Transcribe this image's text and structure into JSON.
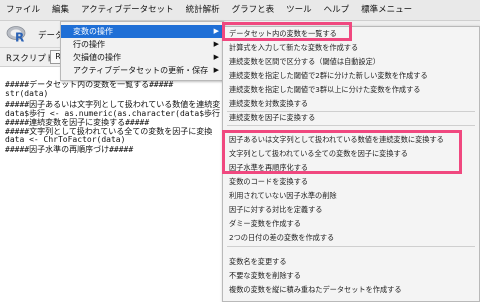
{
  "menubar": [
    "ファイル",
    "編集",
    "アクティブデータセット",
    "統計解析",
    "グラフと表",
    "ツール",
    "ヘルプ",
    "標準メニュー"
  ],
  "toolbar": {
    "label": "データセ"
  },
  "scriptbar": {
    "tab_label": "Rスクリプト",
    "button_label": "R"
  },
  "editor_lines": [
    "#####データセット内の変数を一覧する#####",
    "str(data)",
    "#####因子あるいは文字列として扱われている数値を連続変",
    "data$歩行 <- as.numeric(as.character(data$歩行))",
    "#####連続変数を因子に変換する#####",
    "#####文字列として扱われている全ての変数を因子に変換",
    "data <- ChrToFactor(data)",
    "#####因子水準の再順序づけ#####"
  ],
  "menu1": [
    {
      "label": "変数の操作",
      "active": true
    },
    {
      "label": "行の操作",
      "active": false
    },
    {
      "label": "欠損値の操作",
      "active": false
    },
    {
      "label": "アクティブデータセットの更新・保存",
      "active": false
    }
  ],
  "menu2": [
    "データセット内の変数を一覧する",
    "計算式を入力して新たな変数を作成する",
    "連続変数を区間で区分する（閾値は自動設定）",
    "連続変数を指定した閾値で2群に分けた新しい変数を作成する",
    "連続変数を指定した閾値で3群以上に分けた変数を作成する",
    "連続変数を対数変換する",
    "連続変数を因子に変換する",
    "因子あるいは文字列として扱われている数値を連続変数に変換する",
    "文字列として扱われている全ての変数を因子に変換する",
    "因子水準を再順序化する",
    "変数のコードを変換する",
    "利用されていない因子水準の削除",
    "因子に対する対比を定義する",
    "ダミー変数を作成する",
    "2つの日付の差の変数を作成する",
    "変数名を変更する",
    "不要な変数を削除する",
    "複数の変数を縦に積み重ねたデータセットを作成する"
  ],
  "colors": {
    "highlight": "#f0487f",
    "menu_active": "#1f6fd6"
  }
}
